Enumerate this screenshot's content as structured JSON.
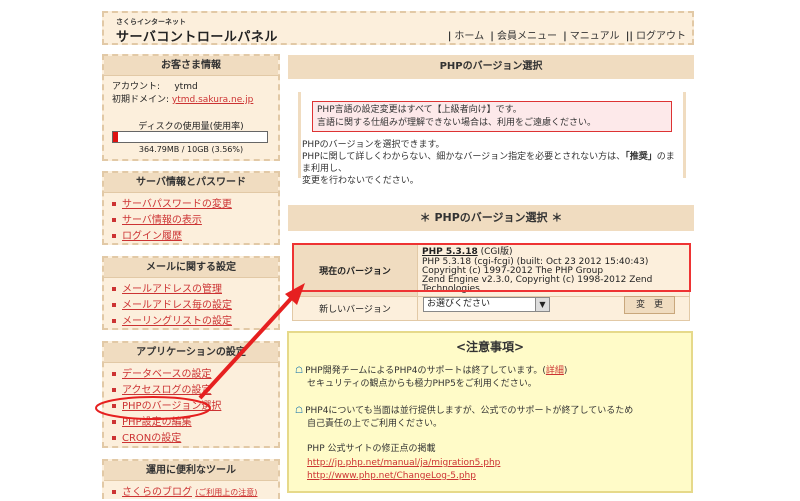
{
  "header": {
    "logo_small": "さくらインターネット",
    "logo_main": "サーバコントロールパネル",
    "nav": [
      "ホーム",
      "会員メニュー",
      "マニュアル",
      "ログアウト"
    ]
  },
  "account": {
    "title": "お客さま情報",
    "account_label": "アカウント:",
    "account_value": "ytmd",
    "domain_label": "初期ドメイン:",
    "domain_value": "ytmd.sakura.ne.jp",
    "disk_label": "ディスクの使用量(使用率)",
    "disk_usage_fraction": 0.0356,
    "disk_text": "364.79MB / 10GB (3.56%)"
  },
  "server_info": {
    "title": "サーバ情報とパスワード",
    "items": [
      "サーバパスワードの変更",
      "サーバ情報の表示",
      "ログイン履歴"
    ]
  },
  "mail": {
    "title": "メールに関する設定",
    "items": [
      "メールアドレスの管理",
      "メールアドレス毎の設定",
      "メーリングリストの設定"
    ]
  },
  "apps": {
    "title": "アプリケーションの設定",
    "items": [
      "データベースの設定",
      "アクセスログの設定",
      "PHPのバージョン選択",
      "PHP設定の編集",
      "CRONの設定"
    ]
  },
  "tools": {
    "title": "運用に便利なツール",
    "items": [
      "さくらのブログ",
      "(ご利用上の注意)"
    ]
  },
  "main": {
    "page_title": "PHPのバージョン選択",
    "warning_line1": "PHP言語の設定変更はすべて【上級者向け】です。",
    "warning_line2": "言語に関する仕組みが理解できない場合は、利用をご遠慮ください。",
    "info_line1": "PHPのバージョンを選択できます。",
    "info_line2a": "PHPに関して詳しくわからない、細かなバージョン指定を必要とされない方は、",
    "info_line2_bold": "「推奨」",
    "info_line2b": "のまま利用し、",
    "info_line3": "変更を行わないでください。",
    "section_title": "＊ PHPのバージョン選択 ＊",
    "current_label": "現在のバージョン",
    "current_version": "PHP 5.3.18",
    "current_version_suffix": "(CGI版)",
    "version_line1": "PHP 5.3.18 (cgi-fcgi) (built: Oct 23 2012 15:40:43)",
    "version_line2": "Copyright (c) 1997-2012 The PHP Group",
    "version_line3": "Zend Engine v2.3.0, Copyright (c) 1998-2012 Zend Technologies",
    "new_label": "新しいバージョン",
    "select_value": "お選びください",
    "change_button": "変　更"
  },
  "caution": {
    "title": "<注意事項>",
    "line1a": "PHP開発チームによるPHP4のサポートは終了しています。(",
    "line1_link": "詳細",
    "line1b": ")",
    "line2": "セキュリティの観点からも極力PHP5をご利用ください。",
    "line3": "PHP4についても当面は並行提供しますが、公式でのサポートが終了しているため",
    "line4": "自己責任の上でご利用ください。",
    "line5": "PHP 公式サイトの修正点の掲載",
    "link1": "http://jp.php.net/manual/ja/migration5.php",
    "link2": "http://www.php.net/ChangeLog-5.php"
  },
  "colors": {
    "accent_red": "#e33",
    "panel_beige": "#fcefdc",
    "header_beige": "#f0dcc0",
    "caution_yellow": "#fffbc8"
  }
}
